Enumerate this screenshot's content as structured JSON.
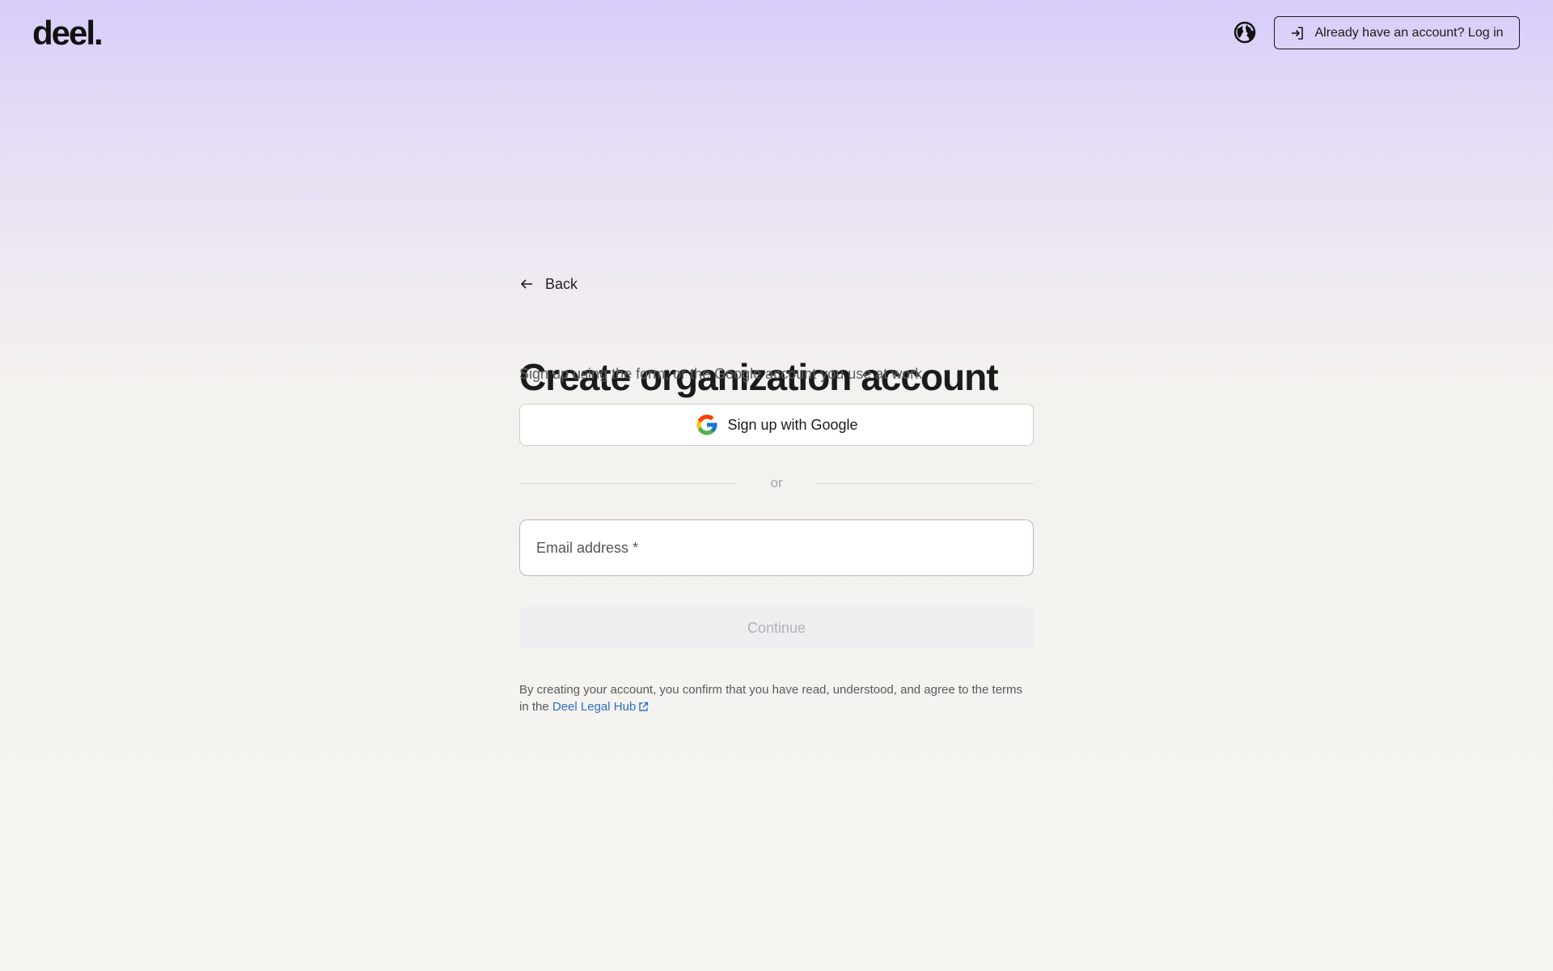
{
  "header": {
    "logo_text": "deel.",
    "globe_icon": "globe-icon",
    "login_icon": "log-in-icon",
    "login_label": "Already have an account? Log in"
  },
  "form": {
    "back_icon": "arrow-left-icon",
    "back_label": "Back",
    "title": "Create organization account",
    "subtitle": "Sign up using the form, or the Google account you use at work",
    "google_icon": "google-icon",
    "google_label": "Sign up with Google",
    "divider_text": "or",
    "email_label": "Email address",
    "email_required": "*",
    "email_value": "",
    "continue_label": "Continue",
    "continue_disabled": true,
    "legal_text": "By creating your account, you confirm that you have read, understood, and agree to the terms in the",
    "legal_link": "Deel Legal Hub",
    "legal_link_icon": "external-link-icon"
  },
  "colors": {
    "accent_link": "#2f6fc7",
    "header_gradient_top": "#d8ccfa",
    "background": "#f5f4f0",
    "disabled_button": "#efedf0"
  }
}
